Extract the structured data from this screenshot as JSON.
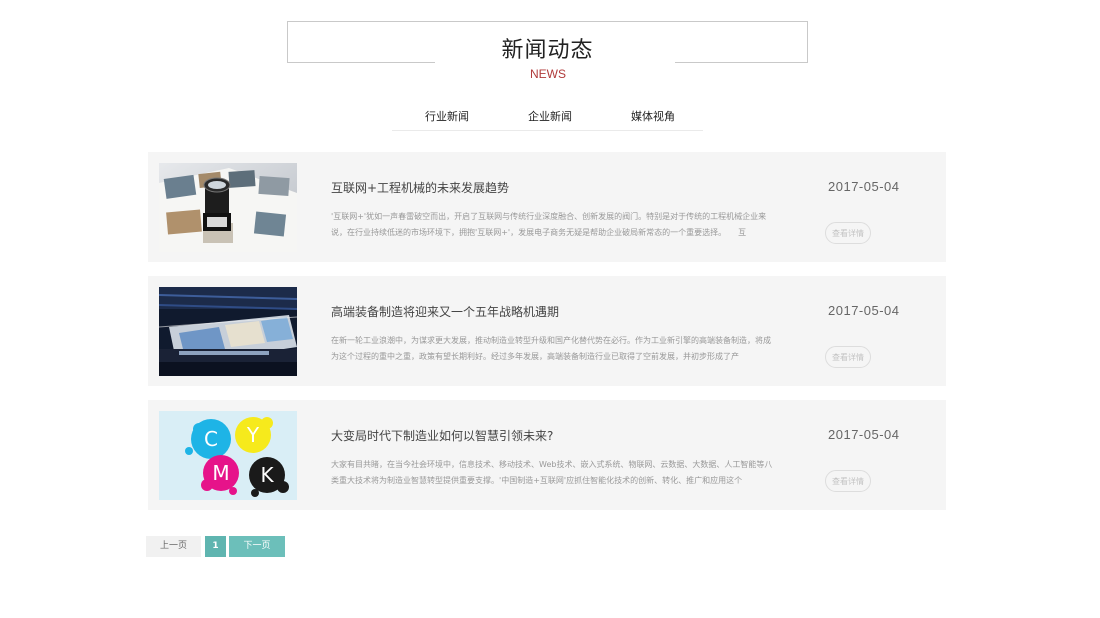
{
  "header": {
    "title": "新闻动态",
    "subtitle": "NEWS"
  },
  "tabs": [
    {
      "label": "行业新闻"
    },
    {
      "label": "企业新闻"
    },
    {
      "label": "媒体视角"
    }
  ],
  "news": [
    {
      "title": "互联网+工程机械的未来发展趋势",
      "summary": "'互联网+'犹如一声春雷破空而出，开启了互联网与传统行业深度融合、创新发展的阀门。特别是对于传统的工程机械企业来说，在行业持续低迷的市场环境下，拥抱'互联网+'，发展电子商务无疑是帮助企业破局新常态的一个重要选择。　　互",
      "date": "2017-05-04",
      "detail_label": "查看详情",
      "thumb_icon": "magnifier-on-prints-image"
    },
    {
      "title": "高端装备制造将迎来又一个五年战略机遇期",
      "summary": "在新一轮工业浪潮中，为谋求更大发展，推动制造业转型升级和国产化替代势在必行。作为工业新引擎的高端装备制造，将成为这个过程的重中之重，政策有望长期利好。经过多年发展，高端装备制造行业已取得了空前发展，并初步形成了产",
      "date": "2017-05-04",
      "detail_label": "查看详情",
      "thumb_icon": "printing-press-image"
    },
    {
      "title": "大变局时代下制造业如何以智慧引领未来?",
      "summary": "大家有目共睹，在当今社会环境中，信息技术、移动技术、Web技术、嵌入式系统、物联网、云数据、大数据、人工智能等八类重大技术将为制造业智慧转型提供重要支撑。'中国制造+互联网'应抓住智能化技术的创新、转化、推广和应用这个",
      "date": "2017-05-04",
      "detail_label": "查看详情",
      "thumb_icon": "cmyk-ink-splash-image",
      "thumb_letters": [
        "C",
        "Y",
        "M",
        "K"
      ]
    }
  ],
  "pagination": {
    "prev_label": "上一页",
    "current": "1",
    "next_label": "下一页"
  },
  "colors": {
    "accent": "#5fb5b0",
    "subtitle": "#b03a3a",
    "card_bg": "#f5f5f5"
  }
}
